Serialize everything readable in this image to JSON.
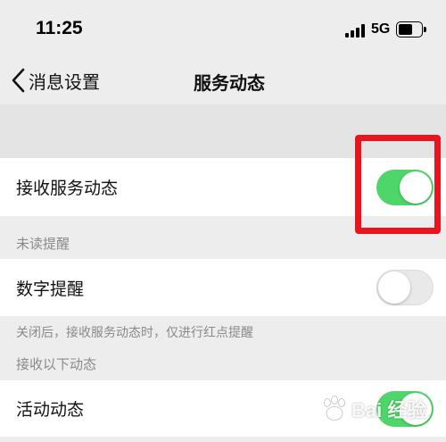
{
  "status_bar": {
    "time": "11:25",
    "network": "5G",
    "battery_level": 0.62
  },
  "nav": {
    "back_label": "消息设置",
    "title": "服务动态"
  },
  "settings": {
    "receive_service": {
      "label": "接收服务动态",
      "enabled": true
    },
    "unread_section_label": "未读提醒",
    "digit_reminder": {
      "label": "数字提醒",
      "enabled": false
    },
    "digit_hint": "关闭后，接收服务动态时，仅进行红点提醒",
    "receive_section_label": "接收以下动态",
    "activity": {
      "label": "活动动态",
      "enabled": true
    }
  },
  "colors": {
    "toggle_on": "#4ed66b",
    "toggle_off": "#e9e9ea",
    "highlight": "#e8141e",
    "background": "#ededed"
  },
  "watermark": {
    "text": "Bai 经验"
  }
}
